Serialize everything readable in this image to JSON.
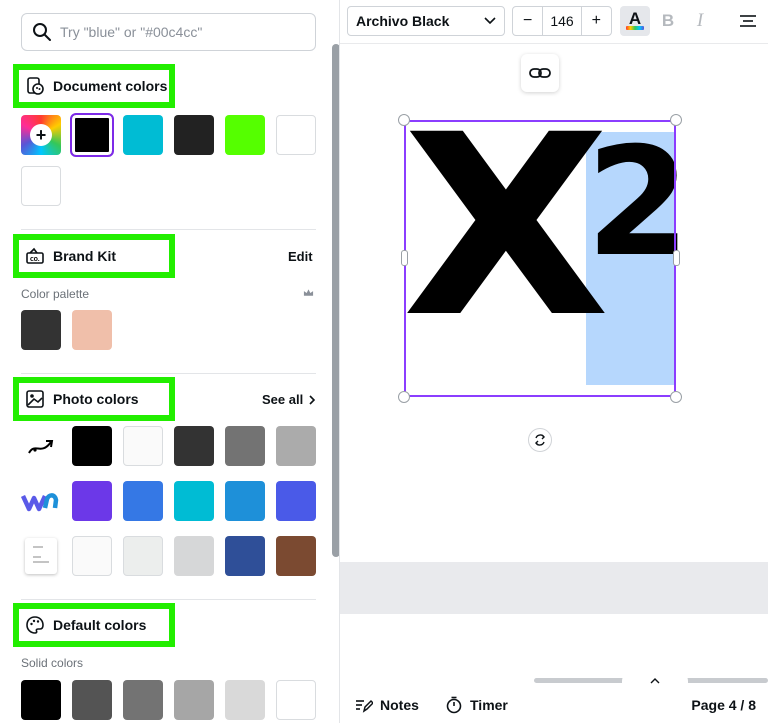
{
  "search": {
    "placeholder": "Try \"blue\" or \"#00c4cc\""
  },
  "sections": {
    "document": {
      "title": "Document colors",
      "swatches": [
        "#000000",
        "#00bcd4",
        "#222222",
        "#55ff00",
        "#ffffff",
        "#ffffff"
      ],
      "selected": "#000000"
    },
    "brand": {
      "title": "Brand Kit",
      "edit_label": "Edit",
      "subtitle": "Color palette",
      "swatches": [
        "#333333",
        "#f0bfaa"
      ]
    },
    "photo": {
      "title": "Photo colors",
      "see_all_label": "See all",
      "rows": [
        [
          "#000000",
          "#fafafa",
          "#333333",
          "#737373",
          "#ababab"
        ],
        [
          "#6c38e8",
          "#3578e5",
          "#00bcd4",
          "#1e90d9",
          "#4a5ae8"
        ],
        [
          "#fafafa",
          "#eceeed",
          "#d6d7d8",
          "#2f4f98",
          "#7b4a31"
        ]
      ]
    },
    "default": {
      "title": "Default colors",
      "subtitle": "Solid colors",
      "swatches": [
        "#000000",
        "#545454",
        "#737373",
        "#a6a6a6",
        "#d9d9d9",
        "#ffffff"
      ]
    }
  },
  "toolbar": {
    "font_name": "Archivo Black",
    "font_size": "146",
    "decrease_label": "−",
    "increase_label": "+",
    "text_color_label": "A",
    "bold_label": "B",
    "italic_label": "I"
  },
  "canvas": {
    "main_text": "X",
    "superscript_text": "2"
  },
  "bottombar": {
    "notes_label": "Notes",
    "timer_label": "Timer",
    "page_indicator": "Page 4 / 8"
  },
  "colors": {
    "accent_purple": "#8b3dff",
    "highlight_green": "#22ee00",
    "selection_blue": "#b6d7fd"
  }
}
